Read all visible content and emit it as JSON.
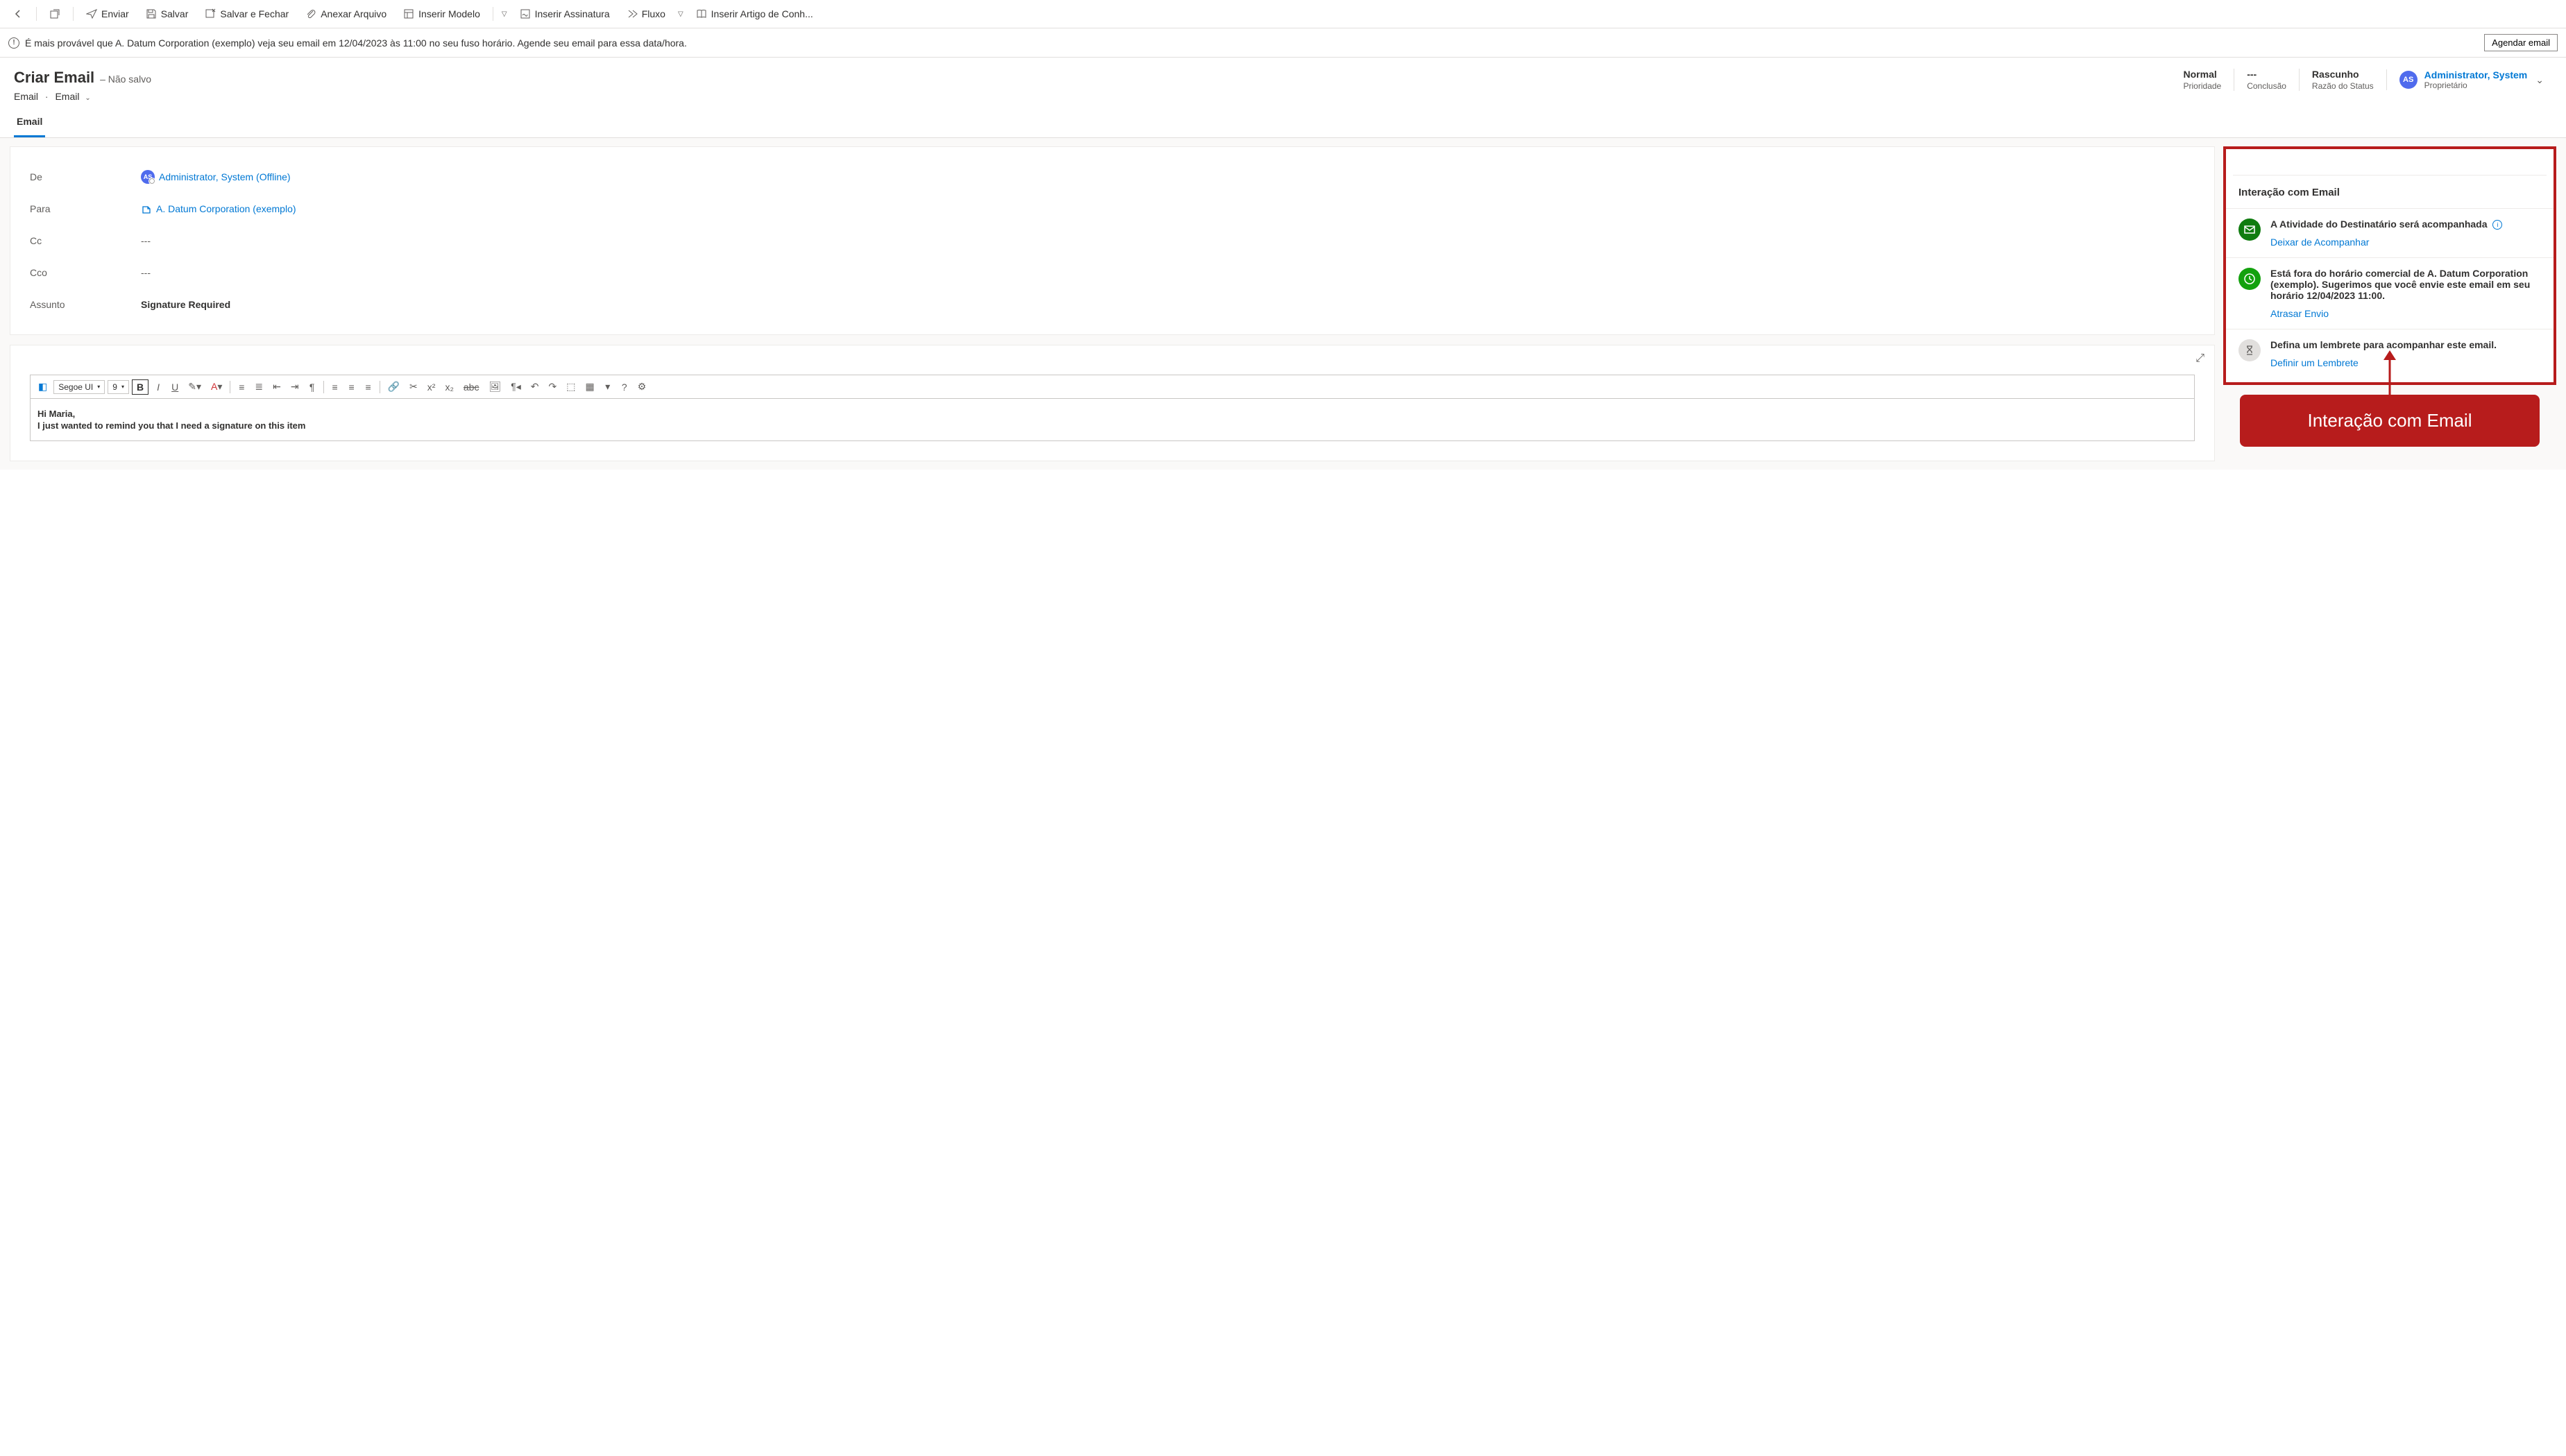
{
  "toolbar": {
    "send": "Enviar",
    "save": "Salvar",
    "save_close": "Salvar e Fechar",
    "attach": "Anexar Arquivo",
    "insert_template": "Inserir Modelo",
    "insert_signature": "Inserir Assinatura",
    "flow": "Fluxo",
    "insert_article": "Inserir Artigo de Conh..."
  },
  "info_bar": {
    "text": "É mais provável que A. Datum Corporation (exemplo) veja seu email em 12/04/2023 às 11:00 no seu fuso horário. Agende seu email para essa data/hora.",
    "button": "Agendar email"
  },
  "header": {
    "title": "Criar Email",
    "unsaved": "– Não salvo",
    "crumb1": "Email",
    "crumb2": "Email",
    "status": [
      {
        "value": "Normal",
        "label": "Prioridade"
      },
      {
        "value": "---",
        "label": "Conclusão"
      },
      {
        "value": "Rascunho",
        "label": "Razão do Status"
      }
    ],
    "owner": {
      "initials": "AS",
      "name": "Administrator, System",
      "label": "Proprietário"
    }
  },
  "tab": "Email",
  "form": {
    "from_label": "De",
    "from_value": "Administrator, System (Offline)",
    "from_initials": "AS",
    "to_label": "Para",
    "to_value": "A. Datum Corporation (exemplo)",
    "cc_label": "Cc",
    "cc_value": "---",
    "bcc_label": "Cco",
    "bcc_value": "---",
    "subject_label": "Assunto",
    "subject_value": "Signature Required"
  },
  "editor": {
    "font": "Segoe UI",
    "size": "9",
    "body_line1": "Hi Maria,",
    "body_line2": "I just wanted to remind you that I need a signature on this item"
  },
  "panel": {
    "title": "Interação com Email",
    "items": [
      {
        "icon": "mail",
        "icon_class": "ic-green",
        "title": "A Atividade do Destinatário será acompanhada",
        "info": true,
        "link": "Deixar de Acompanhar"
      },
      {
        "icon": "clock",
        "icon_class": "ic-lime",
        "title": "Está fora do horário comercial de A. Datum Corporation (exemplo). Sugerimos que você envie este email em seu horário 12/04/2023 11:00.",
        "info": false,
        "link": "Atrasar Envio"
      },
      {
        "icon": "hourglass",
        "icon_class": "ic-gray",
        "title": "Defina um lembrete para acompanhar este email.",
        "info": false,
        "link": "Definir um Lembrete"
      }
    ]
  },
  "callout": "Interação com Email"
}
